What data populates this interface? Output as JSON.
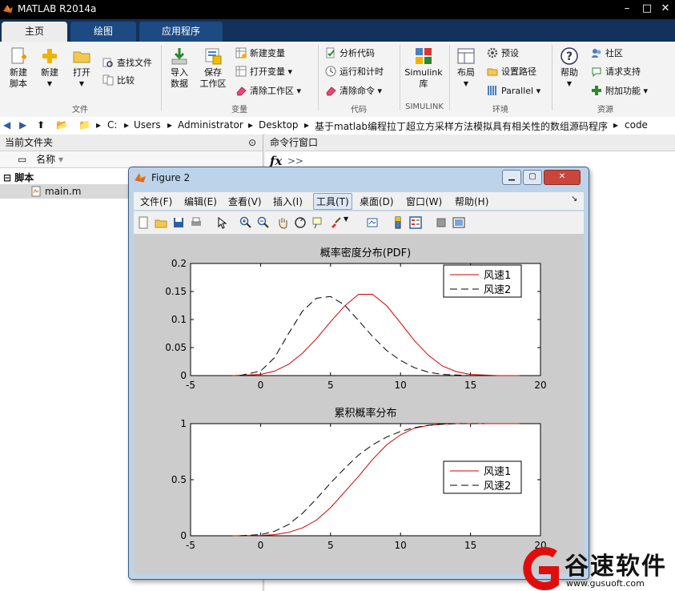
{
  "app": {
    "title": "MATLAB R2014a"
  },
  "tabs": [
    {
      "label": "主页",
      "active": true
    },
    {
      "label": "绘图",
      "active": false
    },
    {
      "label": "应用程序",
      "active": false
    }
  ],
  "ribbon": {
    "new_script": "新建\n脚本",
    "new": "新建",
    "open": "打开",
    "find_files": "查找文件",
    "compare": "比较",
    "import_data": "导入\n数据",
    "save_workspace": "保存\n工作区",
    "new_variable": "新建变量",
    "open_variable": "打开变量",
    "clear_workspace": "清除工作区",
    "analyze_code": "分析代码",
    "run_time": "运行和计时",
    "clear_commands": "清除命令",
    "simulink": "Simulink\n库",
    "layout": "布局",
    "preferences": "预设",
    "set_path": "设置路径",
    "parallel": "Parallel",
    "help": "帮助",
    "community": "社区",
    "request_support": "请求支持",
    "addons": "附加功能",
    "groups": {
      "file": "文件",
      "variable": "变量",
      "code": "代码",
      "simulink": "SIMULINK",
      "environment": "环境",
      "resources": "资源"
    }
  },
  "address": {
    "parts": [
      "C:",
      "Users",
      "Administrator",
      "Desktop",
      "基于matlab编程拉丁超立方采样方法模拟具有相关性的数组源码程序",
      "code"
    ]
  },
  "current_folder": {
    "title": "当前文件夹",
    "column_name": "名称",
    "group": "脚本",
    "file": "main.m"
  },
  "command_window": {
    "title": "命令行窗口",
    "fx": "fx",
    "prompt": ">>"
  },
  "figure": {
    "title": "Figure 2",
    "menu": [
      "文件(F)",
      "编辑(E)",
      "查看(V)",
      "插入(I)",
      "工具(T)",
      "桌面(D)",
      "窗口(W)",
      "帮助(H)"
    ],
    "active_menu": "工具(T)"
  },
  "chart_data": [
    {
      "type": "line",
      "title": "概率密度分布(PDF)",
      "xlim": [
        -5,
        20
      ],
      "ylim": [
        0,
        0.2
      ],
      "xticks": [
        "-5",
        "0",
        "5",
        "10",
        "15",
        "20"
      ],
      "yticks": [
        "0",
        "0.05",
        "0.1",
        "0.15",
        "0.2"
      ],
      "legend_position": "top-right",
      "series": [
        {
          "name": "风速1",
          "color": "#d00000",
          "style": "solid",
          "x": [
            -2,
            0,
            1,
            2,
            3,
            4,
            5,
            6,
            7,
            8,
            9,
            10,
            11,
            12,
            13,
            14,
            15,
            17,
            18.5
          ],
          "y": [
            0,
            0.002,
            0.008,
            0.02,
            0.04,
            0.066,
            0.096,
            0.124,
            0.145,
            0.145,
            0.125,
            0.094,
            0.062,
            0.036,
            0.017,
            0.007,
            0.002,
            0,
            0
          ]
        },
        {
          "name": "风速2",
          "color": "#000000",
          "style": "dashed",
          "x": [
            -1.5,
            0,
            1,
            2,
            3,
            4,
            5,
            6,
            7,
            8,
            9,
            10,
            11,
            12,
            13,
            14,
            15,
            16
          ],
          "y": [
            0,
            0.008,
            0.032,
            0.075,
            0.115,
            0.138,
            0.141,
            0.126,
            0.098,
            0.07,
            0.045,
            0.027,
            0.014,
            0.006,
            0.002,
            0.001,
            0,
            0
          ]
        }
      ]
    },
    {
      "type": "line",
      "title": "累积概率分布",
      "xlim": [
        -5,
        20
      ],
      "ylim": [
        0,
        1
      ],
      "xticks": [
        "-5",
        "0",
        "5",
        "10",
        "15",
        "20"
      ],
      "yticks": [
        "0",
        "0.5",
        "1"
      ],
      "legend_position": "center-right",
      "series": [
        {
          "name": "风速1",
          "color": "#d00000",
          "style": "solid",
          "x": [
            -2,
            0,
            1,
            2,
            3,
            4,
            5,
            6,
            7,
            8,
            9,
            10,
            11,
            12,
            13,
            14,
            15,
            17,
            18.5
          ],
          "y": [
            0,
            0.003,
            0.01,
            0.03,
            0.07,
            0.14,
            0.25,
            0.39,
            0.53,
            0.68,
            0.81,
            0.9,
            0.96,
            0.985,
            0.996,
            1,
            1,
            1,
            1
          ]
        },
        {
          "name": "风速2",
          "color": "#000000",
          "style": "dashed",
          "x": [
            -1.5,
            0,
            1,
            2,
            3,
            4,
            5,
            6,
            7,
            8,
            9,
            10,
            11,
            12,
            13,
            14,
            16
          ],
          "y": [
            0,
            0.01,
            0.04,
            0.1,
            0.2,
            0.33,
            0.47,
            0.6,
            0.72,
            0.81,
            0.88,
            0.93,
            0.965,
            0.985,
            0.995,
            1,
            1
          ]
        }
      ]
    }
  ],
  "watermark": {
    "name": "谷速软件",
    "url": "www.gusuoft.com"
  }
}
